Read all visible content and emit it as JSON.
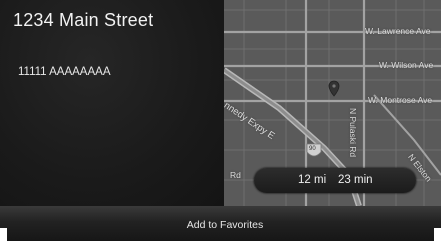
{
  "destination": {
    "address": "1234 Main Street",
    "detail": "11111 AAAAAAAA"
  },
  "map": {
    "street_labels": {
      "lawrence": "W. Lawrence Ave",
      "wilson": "W. Wilson Ave",
      "montrose": "W. Montrose Ave",
      "expressway": "nnedy Expy E",
      "pulaski": "N Pulaski Rd",
      "elston": "N Elston",
      "rd": "Rd"
    },
    "highway_shield": "90"
  },
  "route": {
    "distance": "12 mi",
    "time": "23 min"
  },
  "actions": {
    "add_to_favorites": "Add to Favorites"
  },
  "colors": {
    "map_background": "#5a5a5a",
    "major_road": "#9a9a9a",
    "pin": "#3a3a3a"
  }
}
